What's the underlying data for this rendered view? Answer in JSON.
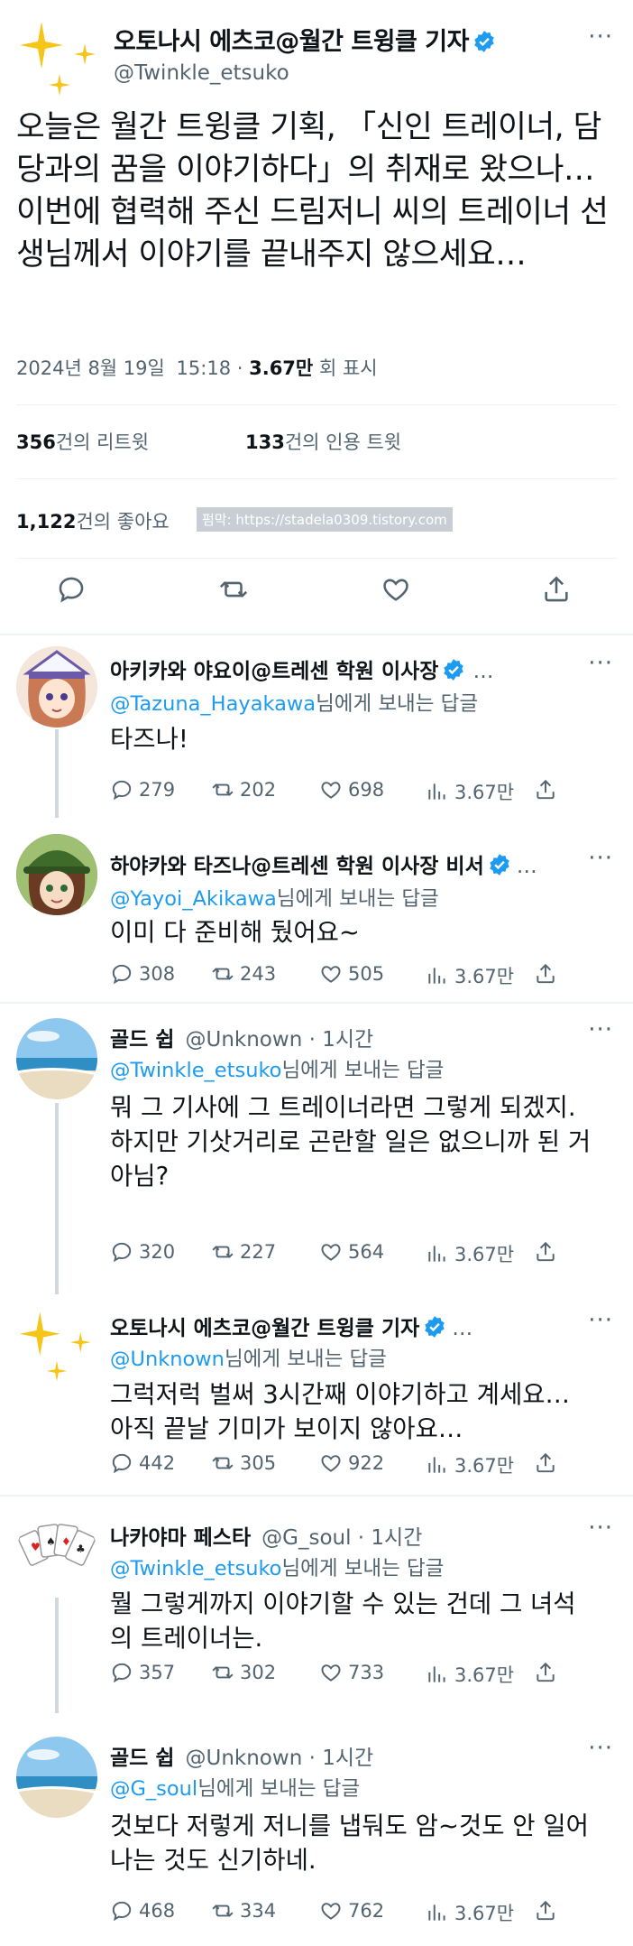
{
  "tweet": {
    "author_name": "오토나시 에츠코@월간 트윙클 기자",
    "author_handle": "@Twinkle_etsuko",
    "text": "오늘은 월간 트윙클 기획, 「신인 트레이너, 담당과의 꿈을 이야기하다」의 취재로 왔으나… 이번에 협력해 주신 드림저니 씨의 트레이너 선생님께서 이야기를 끝내주지 않으세요…",
    "date": "2024년 8월 19일",
    "time": "15:18",
    "views_num": "3.67만",
    "views_label": "회 표시",
    "retweets_num": "356",
    "retweets_label": "건의 리트윗",
    "quotes_num": "133",
    "quotes_label": "건의 인용 트윗",
    "likes_num": "1,122",
    "likes_label": "건의 좋아요",
    "watermark": "펌막: https://stadela0309.tistory.com"
  },
  "reply_to_label": "님에게 보내는 답글",
  "more_label": "···",
  "replies": [
    {
      "name": "아키카와 야요이@트레센 학원 이사장",
      "handle_time": "…",
      "to": "@Tazuna_Hayakawa",
      "text": "타즈나!",
      "comments": "279",
      "retweets": "202",
      "likes": "698",
      "views": "3.67만"
    },
    {
      "name": "하야카와 타즈나@트레센 학원 이사장 비서",
      "handle_time": "…",
      "to": "@Yayoi_Akikawa",
      "text": "이미 다 준비해 뒀어요~",
      "comments": "308",
      "retweets": "243",
      "likes": "505",
      "views": "3.67만"
    },
    {
      "name": "골드 쉽",
      "handle_time": "@Unknown · 1시간",
      "to": "@Twinkle_etsuko",
      "text": "뭐 그 기사에 그 트레이너라면 그렇게 되겠지.\n하지만 기삿거리로 곤란할 일은 없으니까 된 거 아님?",
      "comments": "320",
      "retweets": "227",
      "likes": "564",
      "views": "3.67만"
    },
    {
      "name": "오토나시 에츠코@월간 트윙클 기자",
      "handle_time": "…",
      "to": "@Unknown",
      "text": "그럭저럭 벌써 3시간째 이야기하고 계세요… 아직 끝날 기미가 보이지 않아요…",
      "comments": "442",
      "retweets": "305",
      "likes": "922",
      "views": "3.67만"
    },
    {
      "name": "나카야마 페스타",
      "handle_time": "@G_soul · 1시간",
      "to": "@Twinkle_etsuko",
      "text": "뭘 그렇게까지 이야기할 수 있는 건데 그 녀석의 트레이너는.",
      "comments": "357",
      "retweets": "302",
      "likes": "733",
      "views": "3.67만"
    },
    {
      "name": "골드 쉽",
      "handle_time": "@Unknown · 1시간",
      "to": "@G_soul",
      "text": "것보다 저렇게 저니를 냅둬도 암~것도 안 일어나는 것도 신기하네.",
      "comments": "468",
      "retweets": "334",
      "likes": "762",
      "views": "3.67만"
    }
  ],
  "colors": {
    "accent": "#1d9bf0",
    "muted": "#536471",
    "text": "#0f1419",
    "sparkle": "#f5c518"
  }
}
